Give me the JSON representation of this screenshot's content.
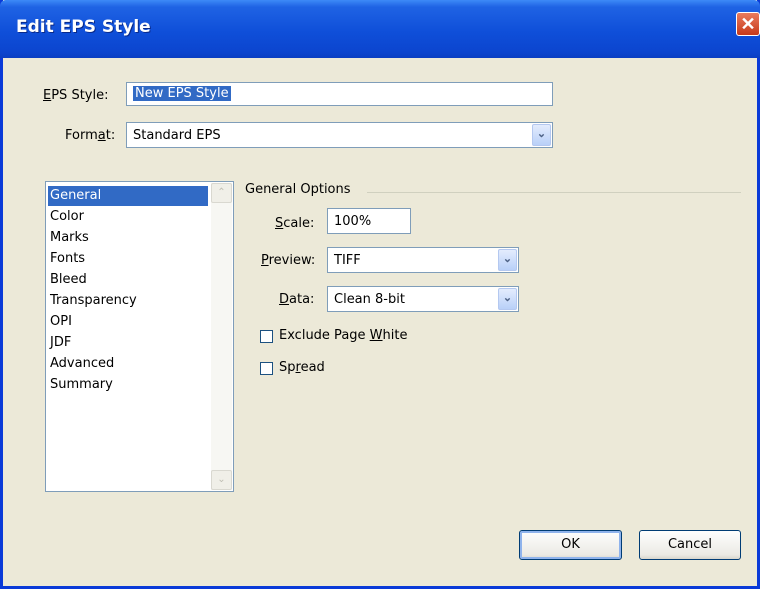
{
  "window": {
    "title": "Edit EPS Style",
    "close_glyph": "✕"
  },
  "form": {
    "eps_style_label_pre": "",
    "eps_style_label_mn": "E",
    "eps_style_label_post": "PS Style:",
    "eps_style_value": "New EPS Style",
    "format_label_pre": "Form",
    "format_label_mn": "a",
    "format_label_post": "t:",
    "format_value": "Standard EPS"
  },
  "nav": {
    "items": [
      "General",
      "Color",
      "Marks",
      "Fonts",
      "Bleed",
      "Transparency",
      "OPI",
      "JDF",
      "Advanced",
      "Summary"
    ],
    "selected": "General"
  },
  "general": {
    "group_title": "General Options",
    "scale_label_mn": "S",
    "scale_label_post": "cale:",
    "scale_value": "100%",
    "preview_label_mn": "P",
    "preview_label_post": "review:",
    "preview_value": "TIFF",
    "data_label_mn": "D",
    "data_label_post": "ata:",
    "data_value": "Clean 8-bit",
    "exclude_label_pre": "Exclude Page ",
    "exclude_label_mn": "W",
    "exclude_label_post": "hite",
    "exclude_checked": false,
    "spread_label_pre": "Sp",
    "spread_label_mn": "r",
    "spread_label_post": "ead",
    "spread_checked": false
  },
  "buttons": {
    "ok": "OK",
    "cancel": "Cancel"
  },
  "icons": {
    "dropdown": "chevron-down-icon",
    "scroll_up": "arrow-up-icon",
    "scroll_down": "arrow-down-icon"
  },
  "colors": {
    "titlebar": "#0b45cf",
    "selection": "#316ac5",
    "dialog_bg": "#ece9d8"
  }
}
